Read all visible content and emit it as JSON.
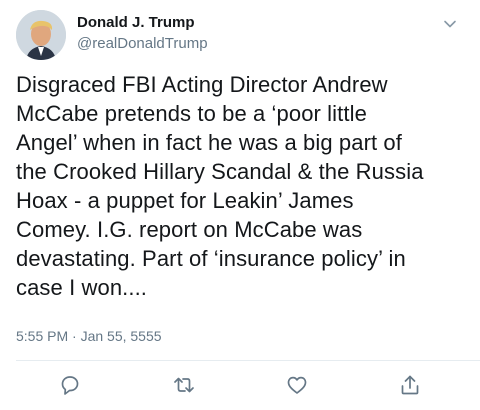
{
  "tweet": {
    "display_name": "Donald J. Trump",
    "handle": "@realDonaldTrump",
    "text": "Disgraced FBI Acting Director Andrew\nMcCabe pretends to be a ‘poor little\nAngel’ when in fact he was a big part of\nthe Crooked Hillary Scandal & the Russia\nHoax - a puppet for Leakin’ James\nComey. I.G. report on McCabe was\ndevastating. Part of ‘insurance policy’ in\ncase I won....",
    "timestamp": "5:55 PM · Jan 55, 5555"
  },
  "icons": {
    "caret": "chevron-down-icon",
    "reply": "reply-icon",
    "retweet": "retweet-icon",
    "like": "heart-icon",
    "share": "share-icon"
  },
  "colors": {
    "text": "#14171a",
    "secondary": "#657786",
    "icon": "#657786",
    "divider": "#e6ecf0"
  }
}
